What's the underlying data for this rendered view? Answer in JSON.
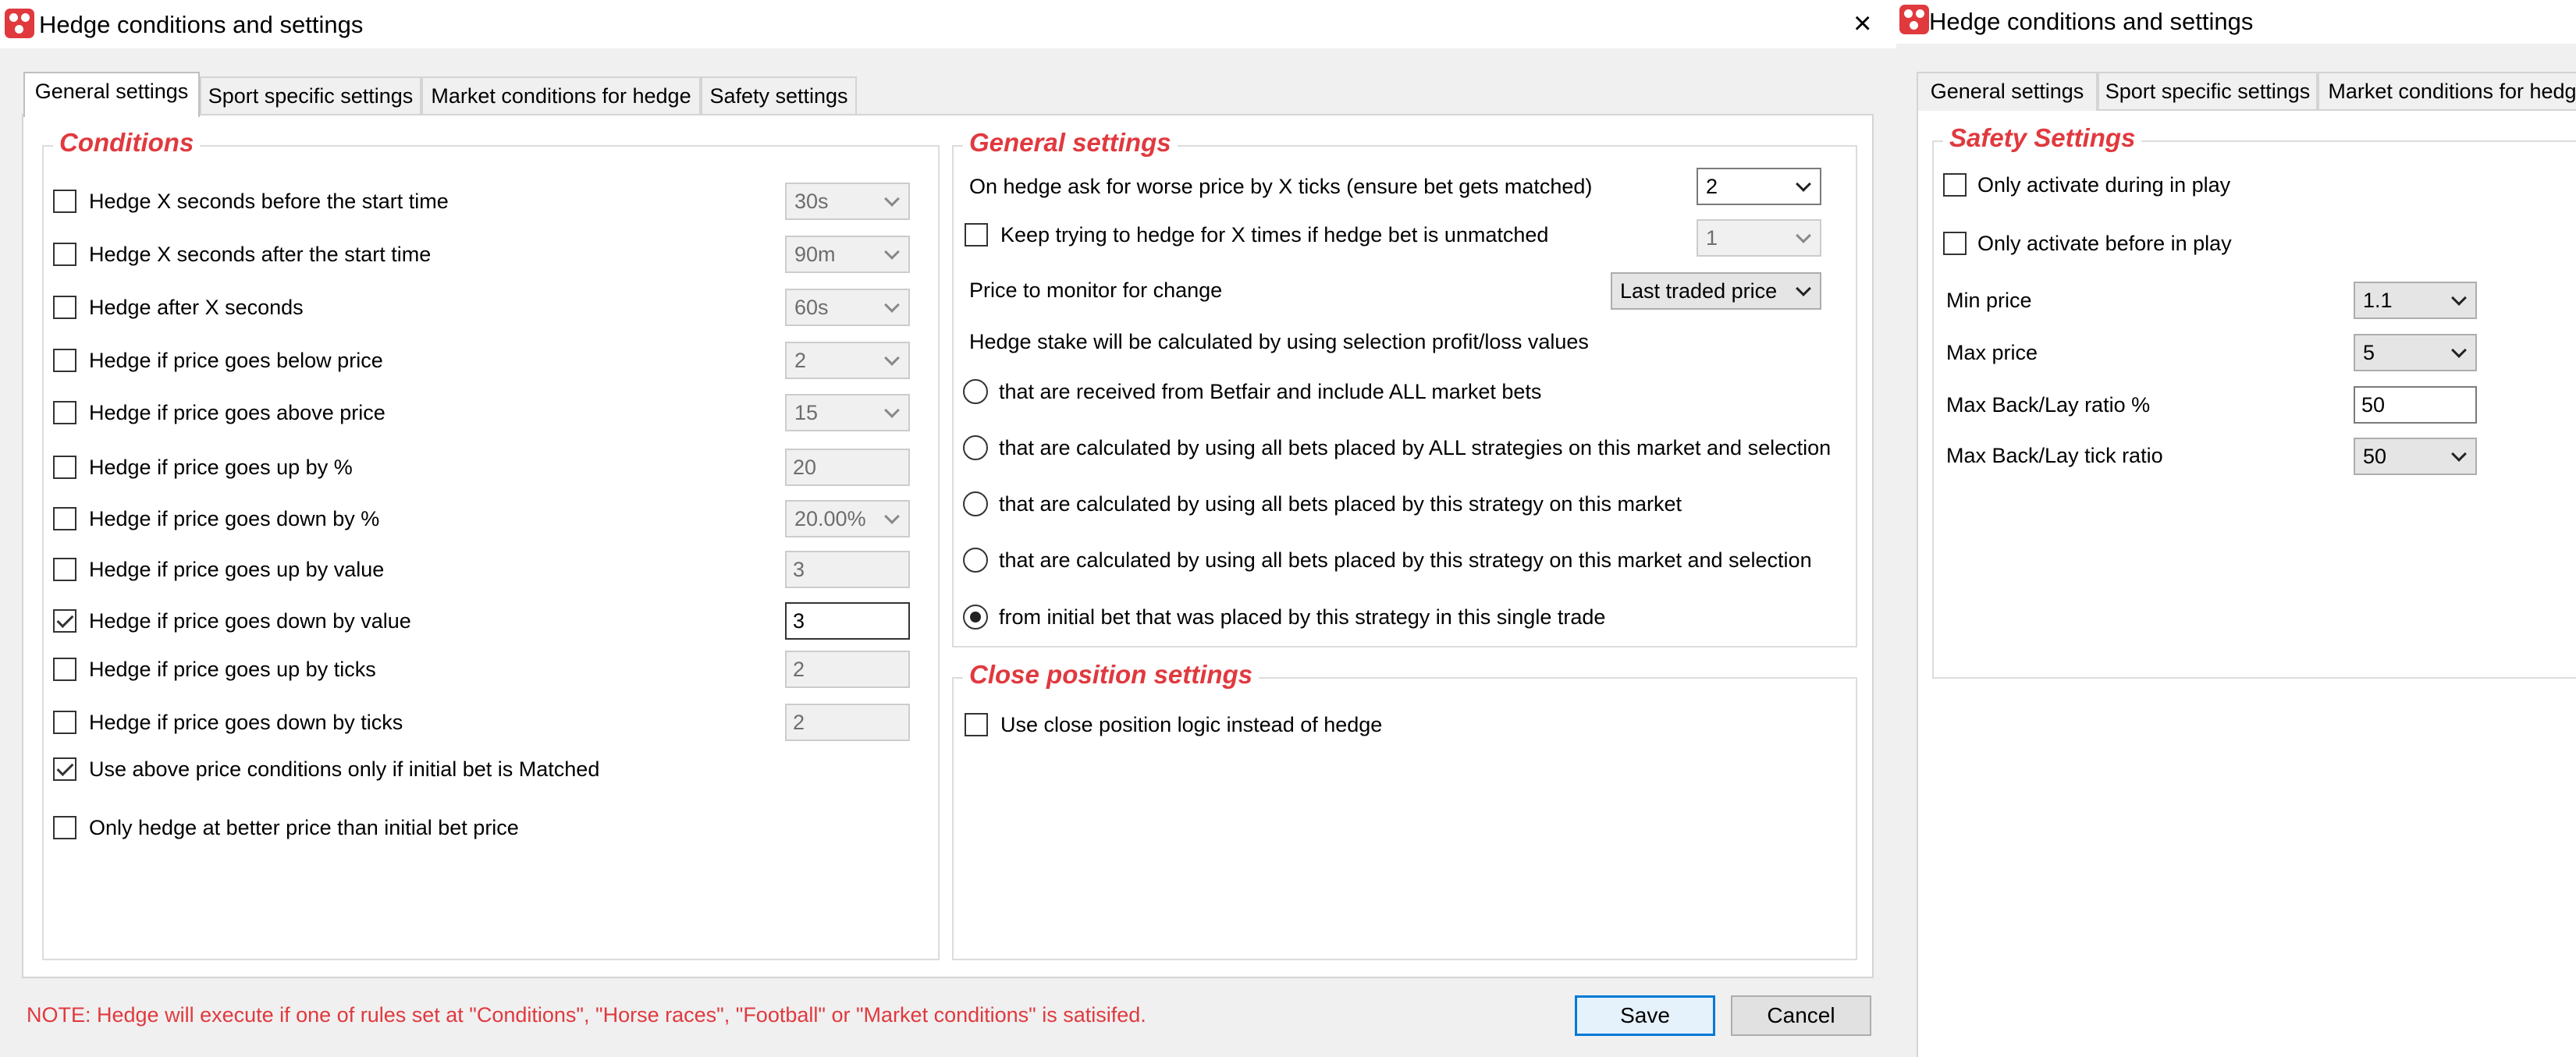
{
  "window": {
    "title": "Hedge conditions and settings",
    "tabs": [
      "General settings",
      "Sport specific settings",
      "Market conditions for hedge",
      "Safety settings"
    ],
    "conditions": {
      "legend": "Conditions",
      "rows": [
        {
          "label": "Hedge X seconds before the start time",
          "checked": false,
          "value": "30s"
        },
        {
          "label": "Hedge X seconds after the start time",
          "checked": false,
          "value": "90m"
        },
        {
          "label": "Hedge after X seconds",
          "checked": false,
          "value": "60s"
        },
        {
          "label": "Hedge if price goes below price",
          "checked": false,
          "value": "2"
        },
        {
          "label": "Hedge if price goes above price",
          "checked": false,
          "value": "15"
        },
        {
          "label": "Hedge if price goes up by %",
          "checked": false,
          "value": "20"
        },
        {
          "label": "Hedge if price goes down by %",
          "checked": false,
          "value": "20.00%"
        },
        {
          "label": "Hedge if price goes up by value",
          "checked": false,
          "value": "3"
        },
        {
          "label": "Hedge if price goes down by value",
          "checked": true,
          "value": "3"
        },
        {
          "label": "Hedge if price goes up by ticks",
          "checked": false,
          "value": "2"
        },
        {
          "label": "Hedge if price goes down by ticks",
          "checked": false,
          "value": "2"
        }
      ],
      "matched_only": {
        "label": "Use above price conditions only if initial bet is Matched",
        "checked": true
      },
      "better_price": {
        "label": "Only hedge at better price than initial bet price",
        "checked": false
      }
    },
    "general": {
      "legend": "General settings",
      "worse_price_label": "On hedge ask for worse price by X ticks (ensure bet gets matched)",
      "worse_price_value": "2",
      "keep_trying_label": "Keep trying to hedge for X times if hedge bet is unmatched",
      "keep_trying_value": "1",
      "monitor_label": "Price to monitor for change",
      "monitor_value": "Last traded price",
      "stake_label": "Hedge stake will be calculated by using selection profit/loss values",
      "radios": [
        {
          "label": "that are received from Betfair and include ALL market bets",
          "checked": false
        },
        {
          "label": "that are calculated by using all bets placed by ALL strategies on this market and selection",
          "checked": false
        },
        {
          "label": "that are calculated by using all bets placed by this strategy on this market",
          "checked": false
        },
        {
          "label": "that are calculated by using all bets placed by this strategy on this market and selection",
          "checked": false
        },
        {
          "label": "from initial bet that was placed by this strategy in this single trade",
          "checked": true
        }
      ]
    },
    "close_position": {
      "legend": "Close position settings",
      "option_label": "Use close position logic instead of hedge"
    },
    "note": "NOTE: Hedge will execute if one of rules set at \"Conditions\", \"Horse races\", \"Football\" or \"Market conditions\" is satisifed.",
    "save_label": "Save",
    "cancel_label": "Cancel"
  },
  "window2": {
    "title": "Hedge conditions and settings",
    "tabs": [
      "General settings",
      "Sport specific settings",
      "Market conditions for hedge"
    ],
    "safety": {
      "legend": "Safety Settings",
      "in_play_label": "Only activate during in play",
      "before_play_label": "Only activate before in play",
      "min_price_label": "Min price",
      "min_price_value": "1.1",
      "max_price_label": "Max price",
      "max_price_value": "5",
      "ratio_label": "Max Back/Lay ratio %",
      "ratio_value": "50",
      "tick_ratio_label": "Max Back/Lay tick ratio",
      "tick_ratio_value": "50"
    }
  },
  "colors": {
    "accent": "#e0393e",
    "focus": "#0078d7",
    "window_bg": "#f0f0f0"
  }
}
